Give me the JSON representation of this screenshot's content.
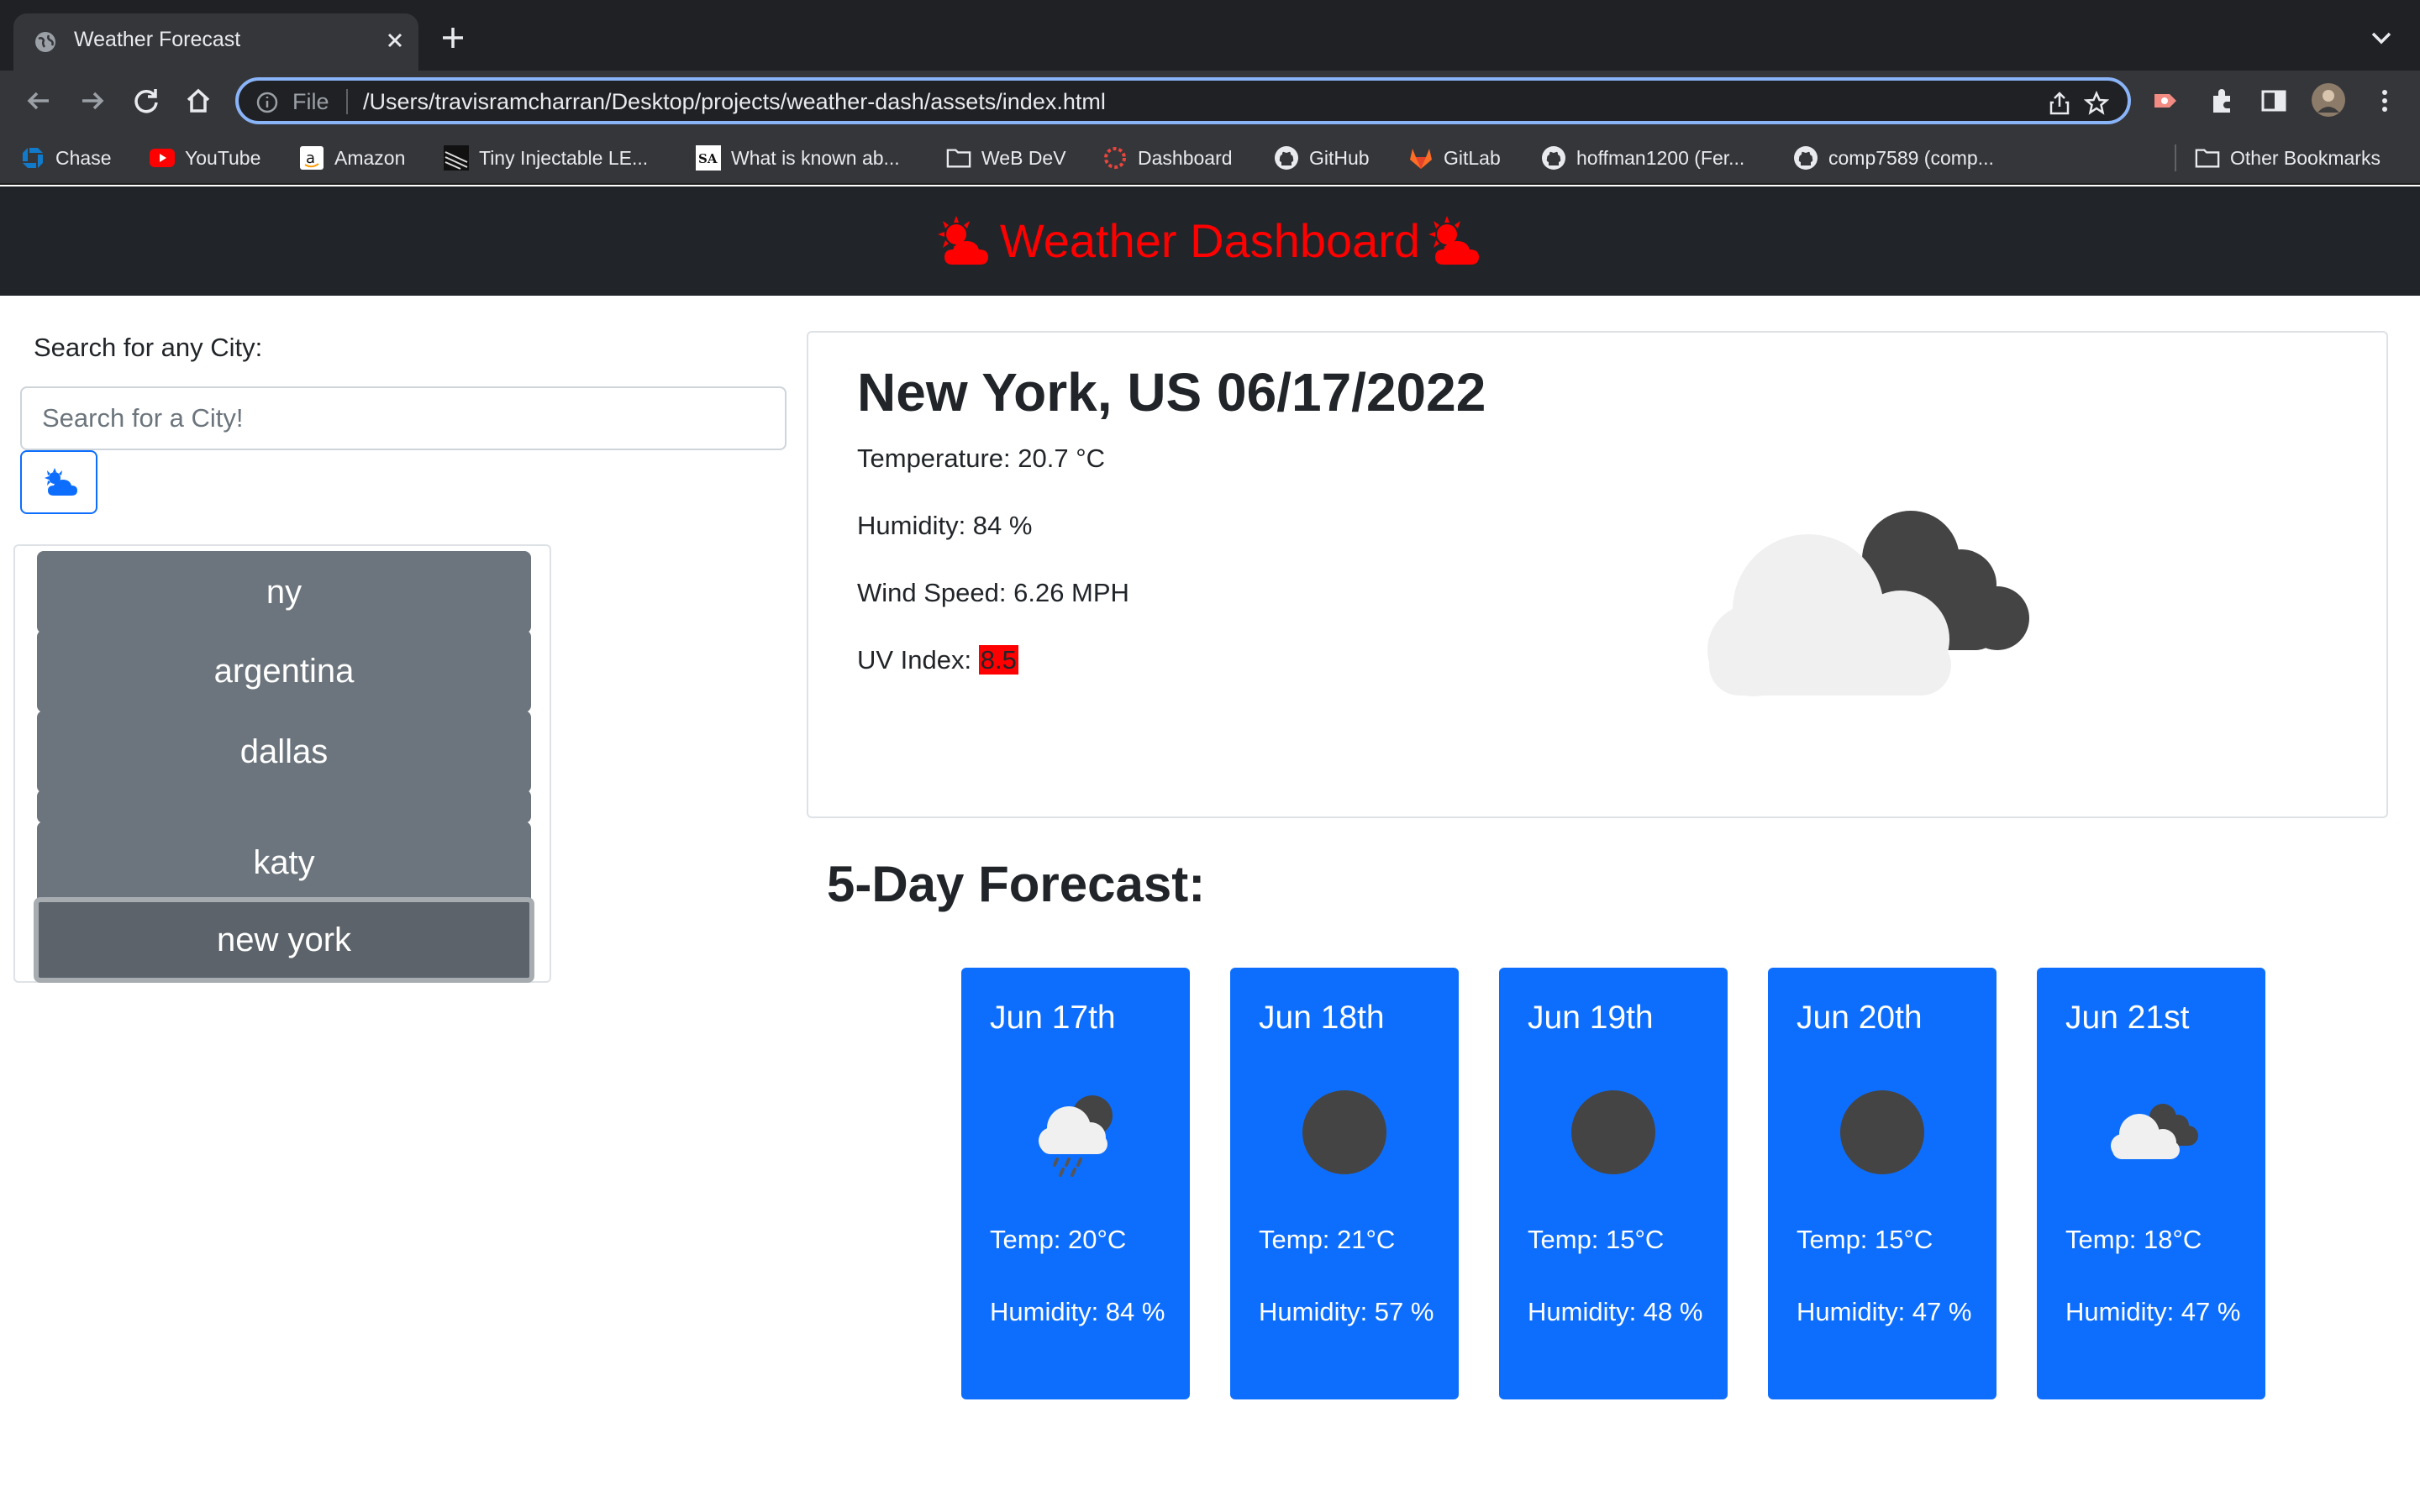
{
  "browser": {
    "tab_title": "Weather Forecast",
    "url_scheme": "File",
    "url": "/Users/travisramcharran/Desktop/projects/weather-dash/assets/index.html",
    "bookmarks": [
      "Chase",
      "YouTube",
      "Amazon",
      "Tiny Injectable LE...",
      "What is known ab...",
      "WeB DeV",
      "Dashboard",
      "GitHub",
      "GitLab",
      "hoffman1200 (Fer...",
      "comp7589 (comp..."
    ],
    "other_bookmarks": "Other Bookmarks"
  },
  "header": {
    "title": "Weather Dashboard",
    "title_color": "#ff0000"
  },
  "search": {
    "label": "Search for any City:",
    "placeholder": "Search for a City!",
    "button_icon": "cloud-sun-icon"
  },
  "history": [
    "ny",
    "argentina",
    "dallas",
    "",
    "katy",
    "new york"
  ],
  "current": {
    "title": "New York, US 06/17/2022",
    "temperature": "Temperature: 20.7 °C",
    "humidity": "Humidity: 84 %",
    "wind": "Wind Speed: 6.26 MPH",
    "uv_label": "UV Index:",
    "uv_value": "8.5",
    "icon": "broken-clouds-icon"
  },
  "forecast": {
    "title": "5-Day Forecast:",
    "days": [
      {
        "date": "Jun 17th",
        "icon": "rain-icon",
        "temp": "Temp: 20°C",
        "humidity": "Humidity: 84 %"
      },
      {
        "date": "Jun 18th",
        "icon": "overcast-icon",
        "temp": "Temp: 21°C",
        "humidity": "Humidity: 57 %"
      },
      {
        "date": "Jun 19th",
        "icon": "overcast-icon",
        "temp": "Temp: 15°C",
        "humidity": "Humidity: 48 %"
      },
      {
        "date": "Jun 20th",
        "icon": "overcast-icon",
        "temp": "Temp: 15°C",
        "humidity": "Humidity: 47 %"
      },
      {
        "date": "Jun 21st",
        "icon": "broken-clouds-icon",
        "temp": "Temp: 18°C",
        "humidity": "Humidity: 47 %"
      }
    ]
  }
}
